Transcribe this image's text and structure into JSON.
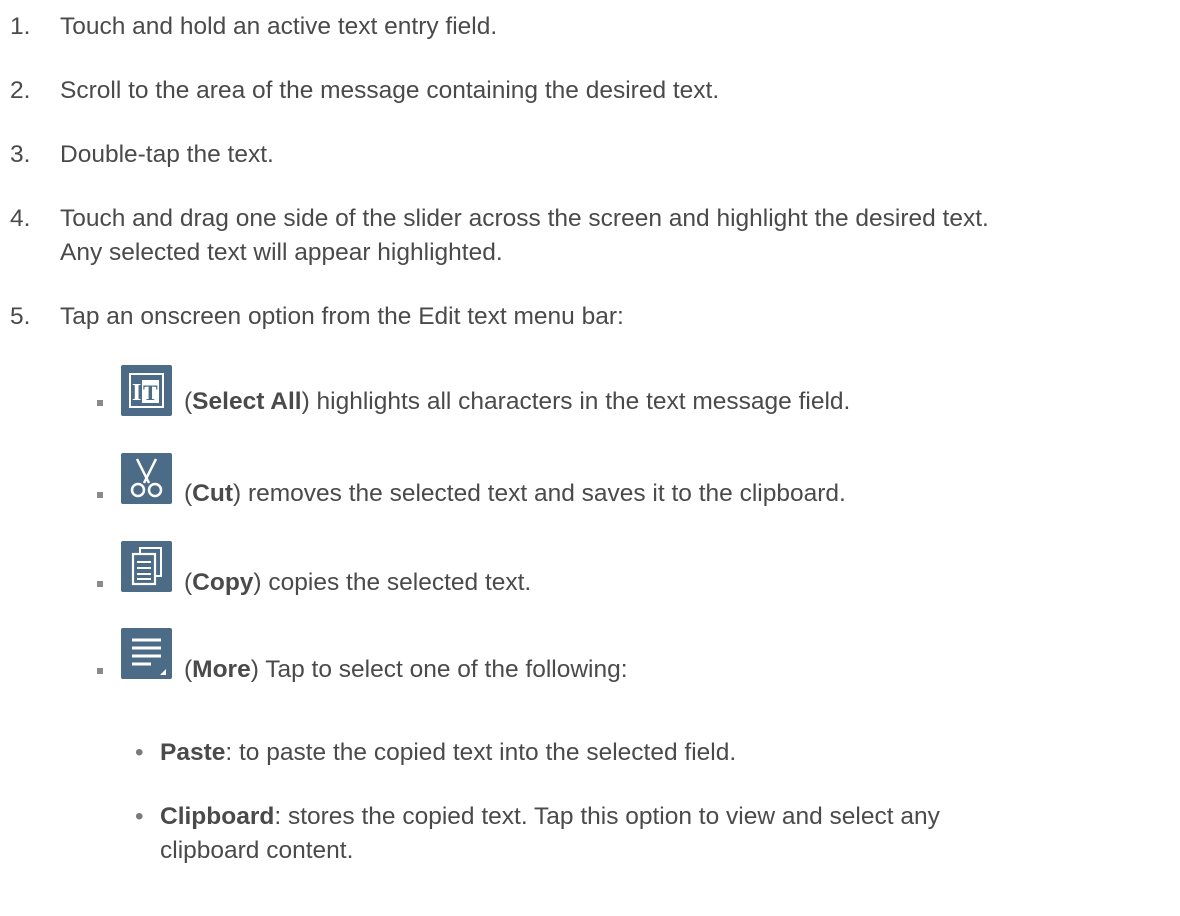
{
  "steps": [
    {
      "num": "1.",
      "text": "Touch and hold an active text entry field."
    },
    {
      "num": "2.",
      "text": "Scroll to the area of the message containing the desired text."
    },
    {
      "num": "3.",
      "text": "Double-tap the text."
    },
    {
      "num": "4.",
      "text": "Touch and drag one side of the slider across the screen and highlight the desired text.",
      "text2": "Any selected text will appear highlighted."
    },
    {
      "num": "5.",
      "text": "Tap an onscreen option from the Edit text menu bar:"
    }
  ],
  "options": [
    {
      "icon": "select-all-icon",
      "open": "(",
      "name": "Select All",
      "rest": ") highlights all characters in the text message field."
    },
    {
      "icon": "scissors-icon",
      "open": "(",
      "name": "Cut",
      "rest": ") removes the selected text and saves it to the clipboard."
    },
    {
      "icon": "copy-icon",
      "open": "(",
      "name": "Copy",
      "rest": ") copies the selected text."
    },
    {
      "icon": "more-icon",
      "open": "(",
      "name": "More",
      "rest": ") Tap to select one of the following:"
    }
  ],
  "more_items": [
    {
      "bullet": "•",
      "name": "Paste",
      "rest": ": to paste the copied text into the selected field."
    },
    {
      "bullet": "•",
      "name": "Clipboard",
      "rest": ": stores the copied text. Tap this option to view and select any",
      "rest2": "clipboard content."
    }
  ],
  "colors": {
    "icon_bg": "#4b6b86",
    "text": "#4a4a4a"
  }
}
